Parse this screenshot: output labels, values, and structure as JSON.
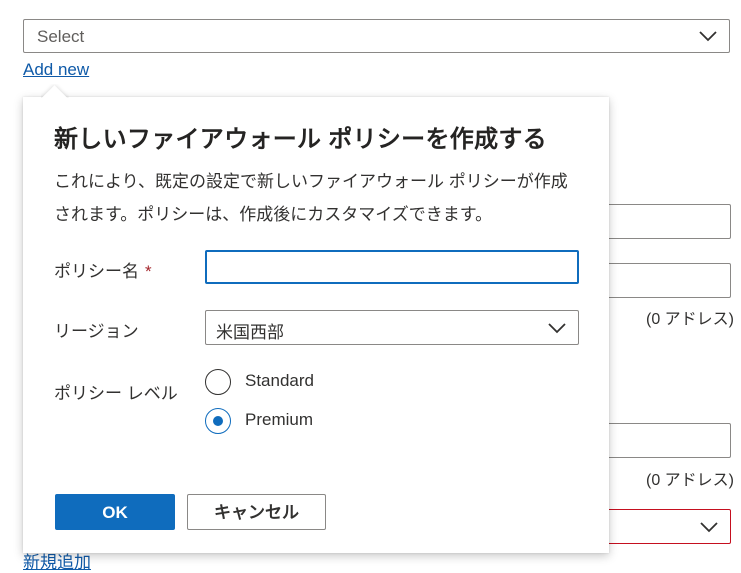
{
  "background": {
    "select_value": "Select",
    "add_new_link": "Add new",
    "address_note_1": "(0 アドレス)",
    "address_note_2": "(0 アドレス)",
    "add_new_link_jp": "新規追加"
  },
  "callout": {
    "title": "新しいファイアウォール ポリシーを作成する",
    "description": "これにより、既定の設定で新しいファイアウォール ポリシーが作成されます。ポリシーは、作成後にカスタマイズできます。",
    "policy_name": {
      "label": "ポリシー名",
      "required_mark": "*",
      "value": ""
    },
    "region": {
      "label": "リージョン",
      "selected": "米国西部"
    },
    "policy_level": {
      "label": "ポリシー レベル",
      "options": [
        {
          "label": "Standard",
          "checked": false
        },
        {
          "label": "Premium",
          "checked": true
        }
      ]
    },
    "ok_button": "OK",
    "cancel_button": "キャンセル"
  },
  "colors": {
    "accent": "#0f6cbd",
    "link": "#0f5aa8",
    "required": "#a4262c",
    "error_border": "#c50f1f"
  },
  "icons": [
    "chevron-down-icon",
    "radio-unchecked-icon",
    "radio-checked-icon"
  ]
}
